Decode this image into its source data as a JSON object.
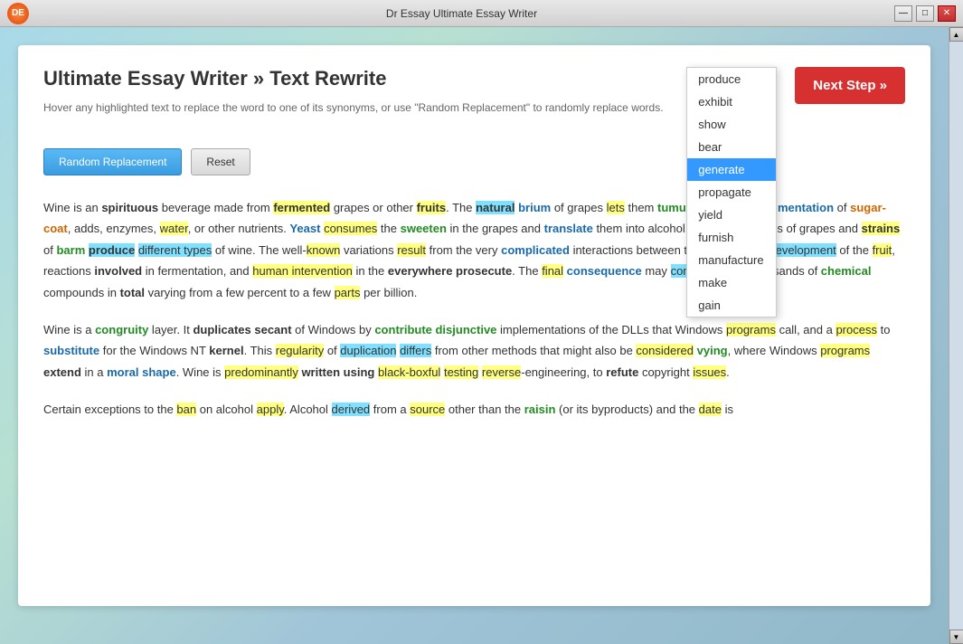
{
  "window": {
    "title": "Dr Essay Ultimate Essay Writer",
    "controls": {
      "minimize": "—",
      "maximize": "□",
      "close": "✕"
    }
  },
  "header": {
    "title": "Ultimate Essay Writer » Text Rewrite",
    "subtitle": "Hover any highlighted text to replace the word to one of its synonyms, or use \"Random Replacement\" to randomly replace words.",
    "next_step_label": "Next Step »"
  },
  "buttons": {
    "random_replacement": "Random Replacement",
    "reset": "Reset"
  },
  "dropdown": {
    "items": [
      "produce",
      "exhibit",
      "show",
      "bear",
      "generate",
      "propagate",
      "yield",
      "furnish",
      "manufacture",
      "make",
      "gain"
    ],
    "selected": "generate"
  },
  "paragraphs": [
    "Wine is an spirituous beverage made from fermented grapes or other fruits. The natural brium of grapes lets them tumult without the augmentation of sugar-coat, adds, enzymes, water, or other nutrients. Yeast consumes the sweeten in the grapes and translate them into alcohol. Different varieties of grapes and strains of barm produce different types of wine. The well-known variations result from the very complicated interactions between the biochemical development of the fruit, reactions involved in fermentation, and human intervention in the everywhere prosecute. The final consequence may contain tens of thousands of chemical compounds in total varying from a few percent to a few parts per billion.",
    "Wine is a congruity layer. It duplicates secant of Windows by contribute disjunctive implementations of the DLLs that Windows programs call, and a process to substitute for the Windows NT kernel. This regularity of duplication differs from other methods that might also be considered vying, where Windows programs extend in a moral shape. Wine is predominantly written using black-boxful testing reverse-engineering, to refute copyright issues.",
    "Certain exceptions to the ban on alcohol apply. Alcohol derived from a source other than the raisin (or its byproducts) and the date is"
  ]
}
